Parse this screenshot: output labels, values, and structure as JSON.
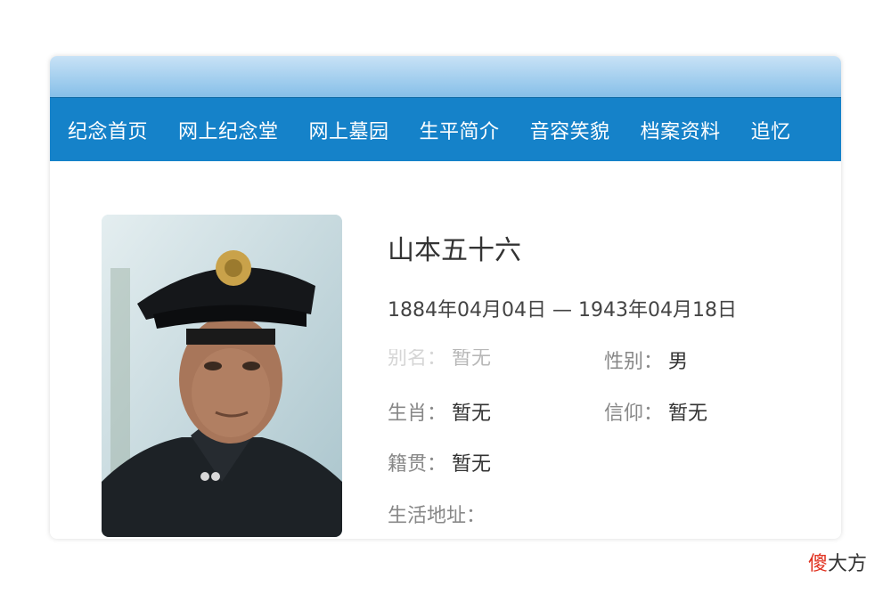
{
  "nav": {
    "items": [
      "纪念首页",
      "网上纪念堂",
      "网上墓园",
      "生平简介",
      "音容笑貌",
      "档案资料",
      "追忆"
    ]
  },
  "profile": {
    "name": "山本五十六",
    "dates": "1884年04月04日 — 1943年04月18日",
    "fields": {
      "alias": {
        "label": "别名：",
        "value": "暂无"
      },
      "gender": {
        "label": "性别：",
        "value": "男"
      },
      "zodiac": {
        "label": "生肖：",
        "value": "暂无"
      },
      "religion": {
        "label": "信仰：",
        "value": "暂无"
      },
      "native_place": {
        "label": "籍贯：",
        "value": "暂无"
      },
      "address": {
        "label": "生活地址：",
        "value": ""
      }
    }
  },
  "watermark": {
    "first_char": "傻",
    "rest": "大方"
  }
}
